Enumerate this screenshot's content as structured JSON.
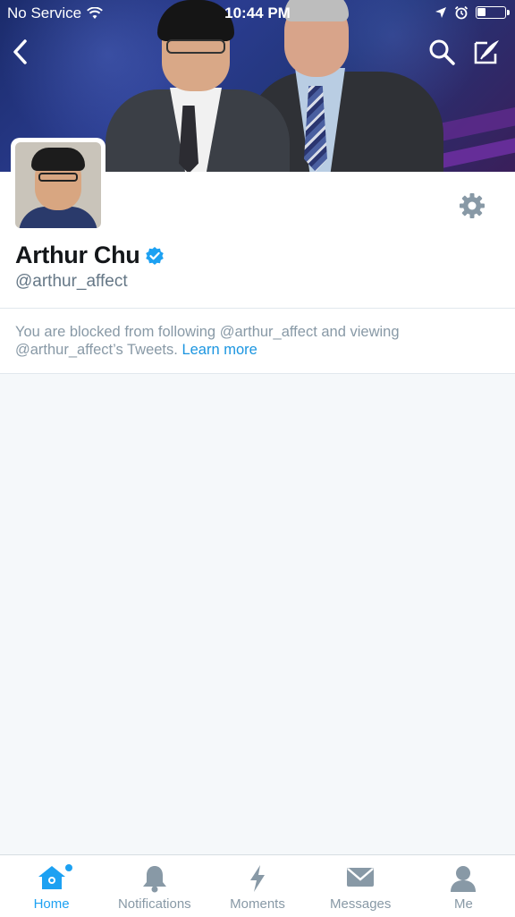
{
  "status_bar": {
    "carrier": "No Service",
    "time": "10:44 PM"
  },
  "profile": {
    "name": "Arthur Chu",
    "handle": "@arthur_affect",
    "verified": true
  },
  "notice": {
    "text": "You are blocked from following @arthur_affect and viewing @arthur_affect’s Tweets.",
    "link": "Learn more"
  },
  "tabs": [
    {
      "label": "Home",
      "icon": "home-icon",
      "active": true,
      "has_badge": true
    },
    {
      "label": "Notifications",
      "icon": "bell-icon",
      "active": false
    },
    {
      "label": "Moments",
      "icon": "lightning-icon",
      "active": false
    },
    {
      "label": "Messages",
      "icon": "envelope-icon",
      "active": false
    },
    {
      "label": "Me",
      "icon": "person-icon",
      "active": false
    }
  ],
  "colors": {
    "accent": "#1da1f2",
    "link": "#1b95e0",
    "muted_text": "#8899a6",
    "background": "#f5f8fa"
  }
}
